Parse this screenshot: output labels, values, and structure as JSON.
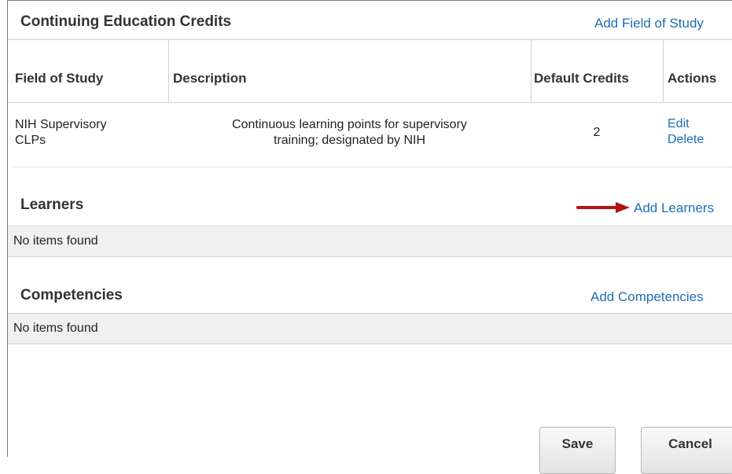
{
  "ce_credits": {
    "title": "Continuing Education Credits",
    "add_link": "Add Field of Study",
    "columns": [
      "Field of Study",
      "Description",
      "Default Credits",
      "Actions"
    ],
    "rows": [
      {
        "field_line1": "NIH Supervisory",
        "field_line2": "CLPs",
        "description_line1": "Continuous learning points for supervisory",
        "description_line2": "training; designated by NIH",
        "credits": "2",
        "edit": "Edit",
        "delete": "Delete"
      }
    ]
  },
  "learners": {
    "title": "Learners",
    "add_link": "Add Learners",
    "empty_text": "No items found"
  },
  "competencies": {
    "title": "Competencies",
    "add_link": "Add Competencies",
    "empty_text": "No items found"
  },
  "buttons": {
    "save": "Save",
    "cancel": "Cancel"
  },
  "colors": {
    "link": "#1c6fb4",
    "arrow": "#b01515"
  }
}
